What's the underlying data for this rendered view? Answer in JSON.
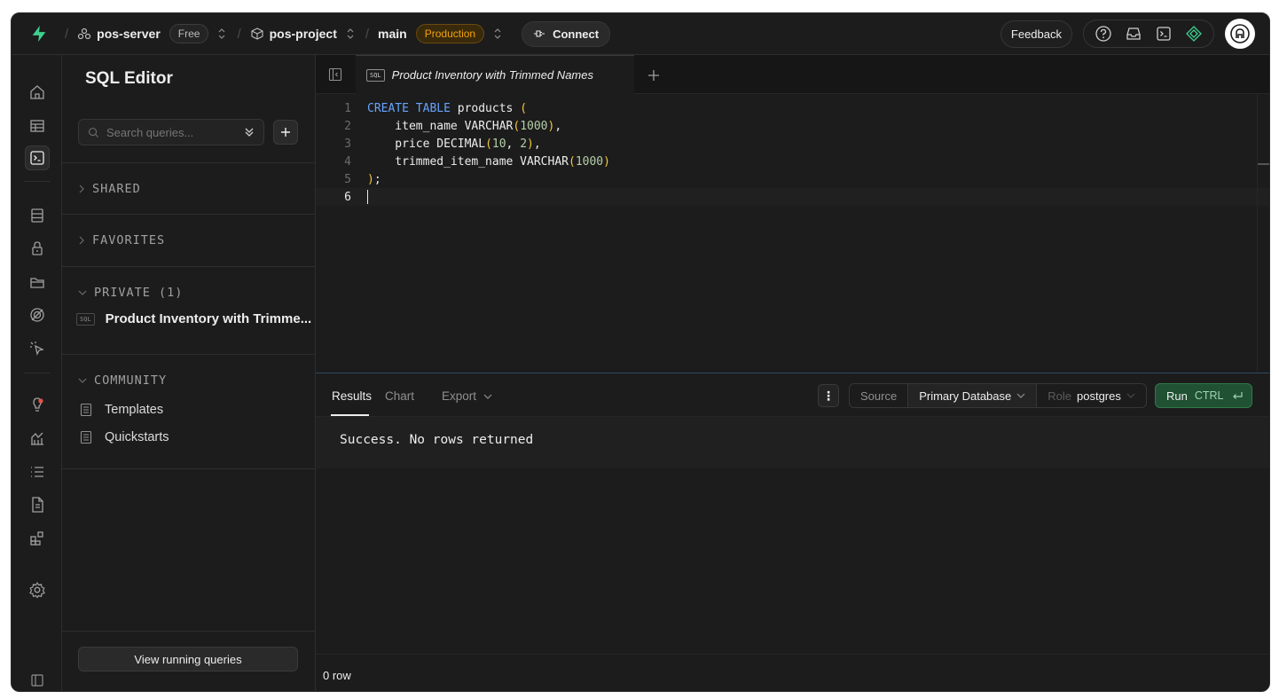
{
  "topbar": {
    "org_name": "pos-server",
    "org_plan": "Free",
    "project_name": "pos-project",
    "branch_name": "main",
    "branch_env": "Production",
    "connect_label": "Connect",
    "feedback_label": "Feedback"
  },
  "sidebar": {
    "title": "SQL Editor",
    "search_placeholder": "Search queries...",
    "sections": {
      "shared": "SHARED",
      "favorites": "FAVORITES",
      "private": "PRIVATE (1)",
      "community": "COMMUNITY"
    },
    "private_query": "Product Inventory with Trimme...",
    "sql_badge": "SQL",
    "community_items": [
      "Templates",
      "Quickstarts"
    ],
    "view_running_label": "View running queries"
  },
  "editor": {
    "tab_badge": "SQL",
    "tab_title": "Product Inventory with Trimmed Names",
    "line_numbers": [
      "1",
      "2",
      "3",
      "4",
      "5",
      "6"
    ],
    "lines": [
      [
        {
          "t": "CREATE TABLE",
          "c": "kw"
        },
        {
          "t": " products ",
          "c": ""
        },
        {
          "t": "(",
          "c": "par"
        }
      ],
      [
        {
          "t": "    item_name VARCHAR",
          "c": ""
        },
        {
          "t": "(",
          "c": "par"
        },
        {
          "t": "1000",
          "c": "num"
        },
        {
          "t": ")",
          "c": "par"
        },
        {
          "t": ",",
          "c": ""
        }
      ],
      [
        {
          "t": "    price DECIMAL",
          "c": ""
        },
        {
          "t": "(",
          "c": "par"
        },
        {
          "t": "10",
          "c": "num"
        },
        {
          "t": ", ",
          "c": ""
        },
        {
          "t": "2",
          "c": "num"
        },
        {
          "t": ")",
          "c": "par"
        },
        {
          "t": ",",
          "c": ""
        }
      ],
      [
        {
          "t": "    trimmed_item_name VARCHAR",
          "c": ""
        },
        {
          "t": "(",
          "c": "par"
        },
        {
          "t": "1000",
          "c": "num"
        },
        {
          "t": ")",
          "c": "par"
        }
      ],
      [
        {
          "t": ")",
          "c": "par"
        },
        {
          "t": ";",
          "c": ""
        }
      ],
      []
    ]
  },
  "results": {
    "tabs": [
      "Results",
      "Chart",
      "Export"
    ],
    "source_label": "Source",
    "source_value": "Primary Database",
    "role_label": "Role",
    "role_value": "postgres",
    "run_label": "Run",
    "run_shortcut": "CTRL",
    "message": "Success. No rows returned",
    "row_count": "0 row"
  }
}
